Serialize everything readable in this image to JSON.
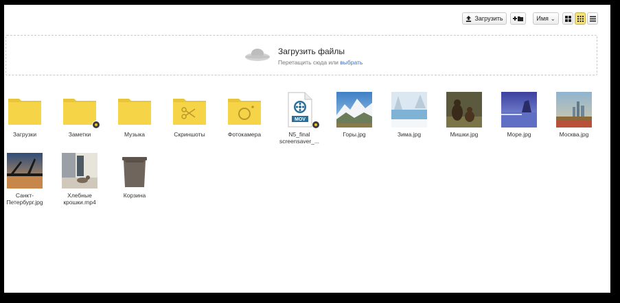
{
  "toolbar": {
    "upload_label": "Загрузить",
    "sort_label": "Имя"
  },
  "dropzone": {
    "title": "Загрузить файлы",
    "subtitle_prefix": "Перетащить сюда или",
    "subtitle_link": "выбрать"
  },
  "items": [
    {
      "label": "Загрузки",
      "type": "folder",
      "icon": "folder-icon"
    },
    {
      "label": "Заметки",
      "type": "folder",
      "icon": "folder-icon",
      "shared": true
    },
    {
      "label": "Музыка",
      "type": "folder",
      "icon": "folder-icon"
    },
    {
      "label": "Скриншоты",
      "type": "folder",
      "icon": "scissors-folder-icon"
    },
    {
      "label": "Фотокамера",
      "type": "folder",
      "icon": "camera-folder-icon"
    },
    {
      "label": "N5_final screensaver_...",
      "type": "video",
      "icon": "mov-file-icon",
      "badge": "MOV",
      "shared": true
    },
    {
      "label": "Горы.jpg",
      "type": "photo"
    },
    {
      "label": "Зима.jpg",
      "type": "photo"
    },
    {
      "label": "Мишки.jpg",
      "type": "photo"
    },
    {
      "label": "Море.jpg",
      "type": "photo"
    },
    {
      "label": "Москва.jpg",
      "type": "photo"
    },
    {
      "label": "Санкт-Петербург.jpg",
      "type": "photo"
    },
    {
      "label": "Хлебные крошки.mp4",
      "type": "video-photo"
    },
    {
      "label": "Корзина",
      "type": "trash",
      "icon": "trash-icon"
    }
  ],
  "colors": {
    "folder": "#f5d547",
    "folder_tab": "#e8c53a",
    "accent_link": "#3a6fc4"
  }
}
